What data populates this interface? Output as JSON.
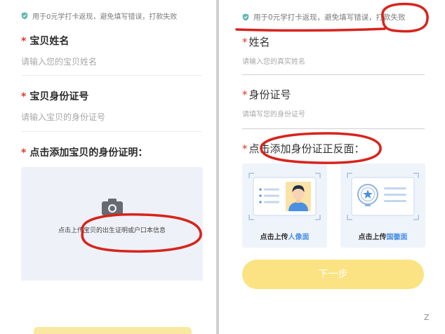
{
  "left": {
    "notice": "用于0元学打卡返现，避免填写错误，打款失败",
    "name_field": {
      "label": "宝贝姓名",
      "placeholder": "请输入您的宝贝姓名"
    },
    "id_field": {
      "label": "宝贝身份证号",
      "placeholder": "请输入宝贝的身份证号"
    },
    "upload_section_label": "点击添加宝贝的身份证明：",
    "upload_caption": "点击上传宝贝的出生证明或户口本信息"
  },
  "right": {
    "notice": "用于0元学打卡返现，避免填写错误，打款失败",
    "name_field": {
      "label": "姓名",
      "placeholder": "请输入您的真实姓名"
    },
    "id_field": {
      "label": "身份证号",
      "placeholder": "请填写您的身份证号"
    },
    "upload_section_label": "点击添加身份证正反面：",
    "portrait_card": {
      "prefix": "点击上传",
      "highlight": "人像面"
    },
    "emblem_card": {
      "prefix": "点击上传",
      "highlight": "国徽面"
    },
    "next_button": "下一步"
  },
  "required_mark": "*",
  "watermark": "Z",
  "colors": {
    "required": "#e0352b",
    "annotation": "#d8231c",
    "accent_blue": "#4a90e2",
    "button_yellow": "#fbe383",
    "shield_teal": "#5fb8b0"
  }
}
